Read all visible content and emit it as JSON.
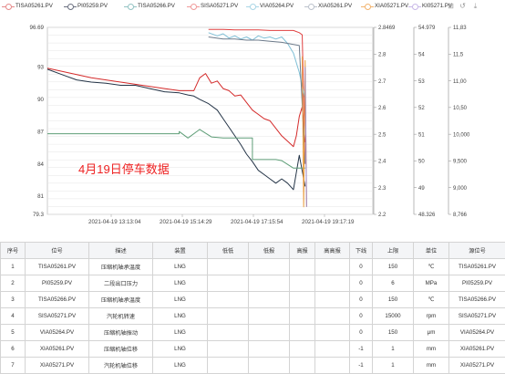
{
  "legend": {
    "items": [
      {
        "label": "TISA05261.PV",
        "color": "#e58a8a",
        "icon": "line-circle-marker"
      },
      {
        "label": "PI05259.PV",
        "color": "#6b7080",
        "icon": "line-circle-marker"
      },
      {
        "label": "TISA05266.PV",
        "color": "#93c3c3",
        "icon": "line-circle-marker"
      },
      {
        "label": "SISA05271.PV",
        "color": "#f09a9a",
        "icon": "line-circle-marker"
      },
      {
        "label": "VIA05264.PV",
        "color": "#a9d6e6",
        "icon": "line-circle-marker"
      },
      {
        "label": "XIA05261.PV",
        "color": "#bcc2cc",
        "icon": "line-circle-marker"
      },
      {
        "label": "XIA05271.PV",
        "color": "#f2b46e",
        "icon": "line-circle-marker"
      },
      {
        "label": "KI05271.PV",
        "color": "#c9b8e8",
        "icon": "line-circle-marker"
      }
    ],
    "tools": [
      "zoom-icon",
      "restore-icon",
      "save-icon"
    ]
  },
  "chart_data": {
    "type": "line",
    "annotation": "4月19日停车数据",
    "annotation_color": "#ee2222",
    "x_tick_labels": [
      "2021-04-19 13:13:04",
      "2021-04-19 15:14:29",
      "2021-04-19 17:15:54",
      "2021-04-19 19:17:19"
    ],
    "axes": {
      "left": {
        "ylim": [
          79.3,
          96.69
        ],
        "ticks": [
          "96.69",
          "93",
          "90",
          "87",
          "84",
          "81",
          "79.3"
        ]
      },
      "right1": {
        "ylim": [
          2.2,
          2.8469
        ],
        "ticks": [
          "2.8469",
          "2.8",
          "2.7",
          "2.6",
          "2.5",
          "2.4",
          "2.3",
          "2.2"
        ]
      },
      "right2": {
        "ylim": [
          48.326,
          54.979
        ],
        "ticks": [
          "54.979",
          "54",
          "53",
          "52",
          "51",
          "50",
          "49",
          "48.326"
        ]
      },
      "right3": {
        "ylim": [
          8766,
          11.83
        ],
        "ticks": [
          "11,83",
          "11,5",
          "11,00",
          "10,50",
          "10,000",
          "9,500",
          "9,000",
          "8,766"
        ]
      }
    },
    "series": [
      {
        "name": "TISA05261.PV",
        "color": "#d42a2a",
        "x": [
          0,
          5,
          10,
          15,
          20,
          25,
          30,
          35,
          40,
          45,
          50,
          52,
          54,
          56,
          58,
          60,
          62,
          64,
          66,
          68,
          70,
          72,
          74,
          76,
          78,
          80,
          82,
          84,
          85,
          86,
          87,
          88
        ],
        "y": [
          92.9,
          92.6,
          92.3,
          92.0,
          91.8,
          91.6,
          91.4,
          91.2,
          91.0,
          90.8,
          90.8,
          92.0,
          92.4,
          91.5,
          91.7,
          91.0,
          90.8,
          90.3,
          90.4,
          89.7,
          89.0,
          88.6,
          88.2,
          88.0,
          87.3,
          86.6,
          86.1,
          85.6,
          86.6,
          88.4,
          89.3,
          86.0
        ]
      },
      {
        "name": "PI05259.PV",
        "color": "#243447",
        "x": [
          0,
          5,
          10,
          15,
          20,
          25,
          30,
          35,
          40,
          45,
          48,
          50,
          52,
          55,
          58,
          60,
          62,
          64,
          66,
          68,
          70,
          72,
          74,
          76,
          78,
          80,
          82,
          84,
          86,
          88
        ],
        "y": [
          92.8,
          92.3,
          91.8,
          91.6,
          91.5,
          91.3,
          91.3,
          91.0,
          90.7,
          90.6,
          90.4,
          90.3,
          90.0,
          89.6,
          89.0,
          88.2,
          87.4,
          86.6,
          85.8,
          84.9,
          84.2,
          83.4,
          83.0,
          82.6,
          82.2,
          82.6,
          82.2,
          81.6,
          84.8,
          81.9
        ]
      },
      {
        "name": "TISA05266.PV",
        "color": "#5f9e78",
        "x": [
          0,
          45,
          45,
          48,
          52,
          56,
          60,
          64,
          68,
          70,
          70,
          78,
          80,
          84,
          86,
          88
        ],
        "y": [
          86.8,
          86.8,
          87.0,
          86.4,
          87.2,
          86.5,
          86.4,
          86.4,
          86.4,
          86.4,
          84.4,
          84.4,
          84.3,
          83.6,
          83.6,
          83.6
        ]
      },
      {
        "name": "SISA05271.PV",
        "color": "#e04040",
        "x": [
          55,
          60,
          64,
          68,
          72,
          76,
          80,
          84,
          86,
          87,
          88
        ],
        "y": [
          96.5,
          96.5,
          96.45,
          96.45,
          96.45,
          96.4,
          96.4,
          96.4,
          96.2,
          96.0,
          84.0
        ]
      },
      {
        "name": "VIA05264.PV",
        "color": "#7fbfd6",
        "x": [
          55,
          58,
          60,
          62,
          64,
          66,
          68,
          70,
          72,
          74,
          76,
          78,
          80,
          82,
          84,
          86,
          88
        ],
        "y": [
          96.2,
          95.9,
          96.1,
          95.7,
          95.9,
          95.6,
          95.8,
          95.5,
          95.9,
          95.7,
          95.8,
          95.6,
          95.8,
          95.2,
          94.3,
          92.5,
          90.0
        ]
      },
      {
        "name": "XIA05261.PV",
        "color": "#6c7a8a",
        "x": [
          55,
          60,
          64,
          68,
          72,
          76,
          80,
          84,
          86,
          88
        ],
        "y": [
          95.8,
          95.6,
          95.6,
          95.5,
          95.5,
          95.4,
          95.3,
          95.1,
          95.0,
          84.0
        ]
      },
      {
        "name": "XIA05271.PV",
        "color": "#e89a3c",
        "x": [
          87,
          87.5,
          88,
          88.5
        ],
        "y": [
          94.0,
          80.0,
          93.6,
          80.0
        ]
      },
      {
        "name": "KI05271.PV",
        "color": "#9b87c8",
        "x": [
          88,
          88.5
        ],
        "y": [
          93.0,
          80.0
        ]
      }
    ]
  },
  "table": {
    "headers": [
      "序号",
      "位号",
      "描述",
      "装置",
      "低低",
      "低报",
      "高报",
      "高高报",
      "下线",
      "上限",
      "单位",
      "源位号"
    ],
    "rows": [
      [
        "1",
        "TISA05261.PV",
        "压缩机轴承温度",
        "LNG",
        "",
        "",
        "",
        "",
        "0",
        "150",
        "℃",
        "TISA05261.PV"
      ],
      [
        "2",
        "PI05259.PV",
        "二段出口压力",
        "LNG",
        "",
        "",
        "",
        "",
        "0",
        "6",
        "MPa",
        "PI05259.PV"
      ],
      [
        "3",
        "TISA05266.PV",
        "压缩机轴承温度",
        "LNG",
        "",
        "",
        "",
        "",
        "0",
        "150",
        "℃",
        "TISA05266.PV"
      ],
      [
        "4",
        "SISA05271.PV",
        "汽轮机转速",
        "LNG",
        "",
        "",
        "",
        "",
        "0",
        "15000",
        "rpm",
        "SISA05271.PV"
      ],
      [
        "5",
        "VIA05264.PV",
        "压缩机轴振动",
        "LNG",
        "",
        "",
        "",
        "",
        "0",
        "150",
        "μm",
        "VIA05264.PV"
      ],
      [
        "6",
        "XIA05261.PV",
        "压缩机轴位移",
        "LNG",
        "",
        "",
        "",
        "",
        "-1",
        "1",
        "mm",
        "XIA05261.PV"
      ],
      [
        "7",
        "XIA05271.PV",
        "汽轮机轴位移",
        "LNG",
        "",
        "",
        "",
        "",
        "-1",
        "1",
        "mm",
        "XIA05271.PV"
      ],
      [
        "8",
        "KI05271.PV",
        "汽轮机键相位",
        "LNG",
        "",
        "",
        "",
        "",
        "0",
        "15000",
        "rpm",
        "KI05271.PV"
      ]
    ]
  }
}
